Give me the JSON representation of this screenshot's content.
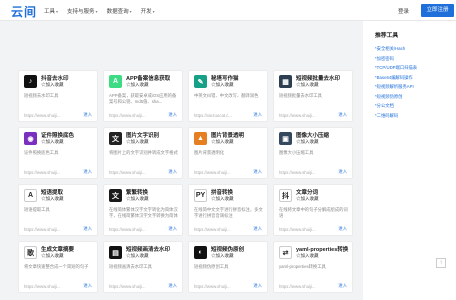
{
  "header": {
    "logo": "云间",
    "nav": [
      {
        "label": "工具",
        "caret": "▾"
      },
      {
        "label": "支持与服务",
        "caret": "▾"
      },
      {
        "label": "数据查询",
        "caret": "▾"
      },
      {
        "label": "开发",
        "caret": "▾"
      }
    ],
    "login": "登录",
    "register": "立即注册"
  },
  "cards": [
    {
      "name": "抖音去水印",
      "tag": "☆加入收藏",
      "desc": "短视频去水印工具",
      "link": "https://www.shuiji...",
      "go": "进入",
      "icon": "douyin-icon",
      "color": "#111111",
      "glyph": "♪"
    },
    {
      "name": "APP备案信息获取",
      "tag": "☆加入收藏",
      "desc": "APP备案，获取安卓或iOS应用的备案号和公钥、md5值、sha...",
      "link": "https://www.shuiji...",
      "go": "进入",
      "icon": "android-icon",
      "color": "#3ddc84",
      "glyph": "A"
    },
    {
      "name": "秘塔写作猫",
      "tag": "☆加入收藏",
      "desc": "中英文纠错、中文改写、翻译润色",
      "link": "https://xiezuocat.c...",
      "go": "进入",
      "icon": "cat-icon",
      "color": "#16a085",
      "glyph": "✎"
    },
    {
      "name": "短视频批量去水印",
      "tag": "☆加入收藏",
      "desc": "短视频批量去水印工具",
      "link": "https://www.shuiji...",
      "go": "进入",
      "icon": "video-batch-icon",
      "color": "#2c3e50",
      "glyph": "▦"
    },
    {
      "name": "证件照换底色",
      "tag": "☆加入收藏",
      "desc": "证件照换底色工具",
      "link": "https://www.shuiji...",
      "go": "进入",
      "icon": "photo-id-icon",
      "color": "#7b2fbe",
      "glyph": "◉"
    },
    {
      "name": "图片文字识别",
      "tag": "☆加入收藏",
      "desc": "将图片上的文字识别并转成文字格式",
      "link": "https://www.shuiji...",
      "go": "进入",
      "icon": "ocr-icon",
      "color": "#222222",
      "glyph": "文"
    },
    {
      "name": "图片背景透明",
      "tag": "☆加入收藏",
      "desc": "图片背景透明化",
      "link": "https://www.shuiji...",
      "go": "进入",
      "icon": "transparent-bg-icon",
      "color": "#e67e22",
      "glyph": "▲"
    },
    {
      "name": "图像大小压缩",
      "tag": "☆加入收藏",
      "desc": "图像大小压缩工具",
      "link": "https://www.shuiji...",
      "go": "进入",
      "icon": "compress-icon",
      "color": "#34495e",
      "glyph": "▣"
    },
    {
      "name": "短语提取",
      "tag": "☆加入收藏",
      "desc": "短语提取工具",
      "link": "https://www.shuiji...",
      "go": "进入",
      "icon": "phrase-extract-icon",
      "color": "#ffffff",
      "glyph": "A"
    },
    {
      "name": "繁繁转换",
      "tag": "☆加入收藏",
      "desc": "在线简体繁体汉字文字转化为简体汉字，在线简繁体汉字文字转换为简体",
      "link": "https://www.shuiji...",
      "go": "进入",
      "icon": "convert-icon",
      "color": "#1a1a1a",
      "glyph": "文"
    },
    {
      "name": "拼音转换",
      "tag": "☆加入收藏",
      "desc": "在线简中文文字进行拼音标注，多文字进行拼音音调标注",
      "link": "https://www.shuiji...",
      "go": "进入",
      "icon": "pinyin-icon",
      "color": "#ffffff",
      "glyph": "PY"
    },
    {
      "name": "文章分词",
      "tag": "☆加入收藏",
      "desc": "在线将文章中的句子分解成组成的词语",
      "link": "https://www.shuiji...",
      "go": "进入",
      "icon": "segment-icon",
      "color": "#ffffff",
      "glyph": "抖"
    },
    {
      "name": "生成文章摘要",
      "tag": "☆加入收藏",
      "desc": "将文章快速整合成一个简短的句子",
      "link": "https://www.shuiji...",
      "go": "进入",
      "icon": "summary-icon",
      "color": "#ffffff",
      "glyph": "歌"
    },
    {
      "name": "短视频画清去水印",
      "tag": "☆加入收藏",
      "desc": "短视频画清去水印工具",
      "link": "https://www.shuiji...",
      "go": "进入",
      "icon": "hd-watermark-icon",
      "color": "#111111",
      "glyph": "▤"
    },
    {
      "name": "短视频伪原创",
      "tag": "☆加入收藏",
      "desc": "短视频伪原创工具",
      "link": "https://www.shuiji...",
      "go": "进入",
      "icon": "pseudo-original-icon",
      "color": "#111111",
      "glyph": "◐"
    },
    {
      "name": "yaml-properties转换",
      "tag": "☆加入收藏",
      "desc": "yaml-properties转换工具",
      "link": "https://www.shuiji...",
      "go": "进入",
      "icon": "yaml-convert-icon",
      "color": "#ffffff",
      "glyph": "⇄"
    }
  ],
  "sidebar": {
    "title": "推荐工具",
    "items": [
      "*安全相关/Hash",
      "*加密密码",
      "*TCP/UDP端口扫描表",
      "*Base64编解码操作",
      "*短视频解析服务API",
      "*短视频伪原创",
      "*分公文档",
      "*二维码解码"
    ]
  },
  "totop": "↑"
}
